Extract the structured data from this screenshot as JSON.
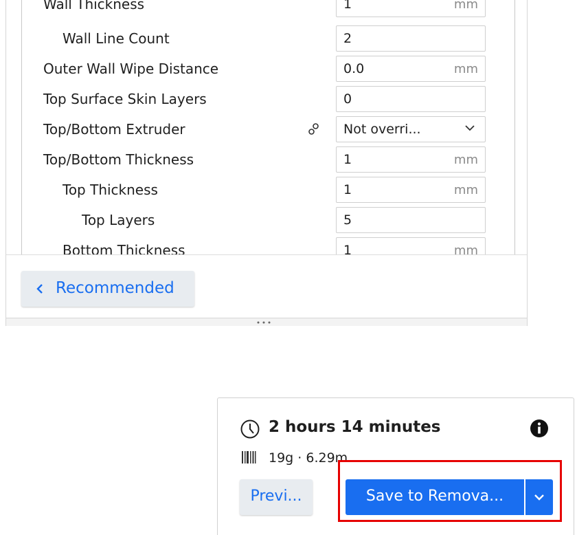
{
  "settings": {
    "rows": [
      {
        "label": "Wall Thickness",
        "value": "1",
        "unit": "mm"
      },
      {
        "label": "Wall Line Count",
        "value": "2",
        "unit": ""
      },
      {
        "label": "Outer Wall Wipe Distance",
        "value": "0.0",
        "unit": "mm"
      },
      {
        "label": "Top Surface Skin Layers",
        "value": "0",
        "unit": ""
      },
      {
        "label": "Top/Bottom Extruder",
        "value": "Not overri...",
        "unit": ""
      },
      {
        "label": "Top/Bottom Thickness",
        "value": "1",
        "unit": "mm"
      },
      {
        "label": "Top Thickness",
        "value": "1",
        "unit": "mm"
      },
      {
        "label": "Top Layers",
        "value": "5",
        "unit": ""
      },
      {
        "label": "Bottom Thickness",
        "value": "1",
        "unit": "mm"
      }
    ],
    "recommended_label": "Recommended"
  },
  "print_summary": {
    "time": "2 hours 14 minutes",
    "material": "19g · 6.29m",
    "preview_label": "Previ...",
    "save_label": "Save to Remova..."
  },
  "colors": {
    "accent": "#196ef0",
    "highlight": "#e60000"
  }
}
